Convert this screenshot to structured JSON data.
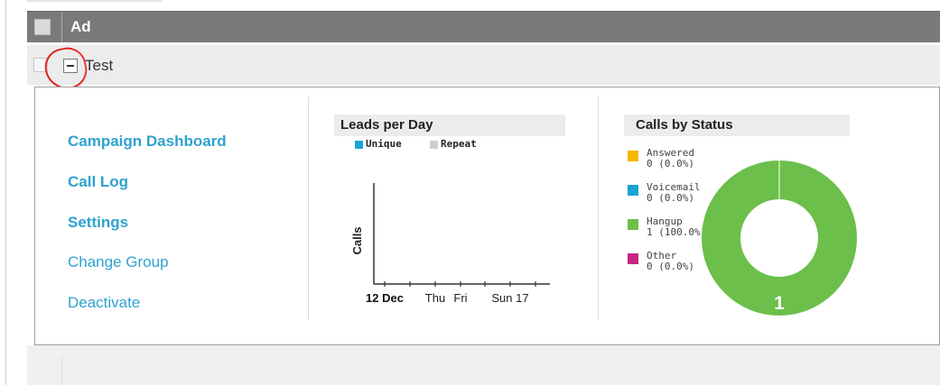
{
  "header": {
    "column_label": "Ad"
  },
  "group": {
    "name": "Test"
  },
  "links": [
    {
      "label": "Campaign Dashboard",
      "bold": true
    },
    {
      "label": "Call Log",
      "bold": true
    },
    {
      "label": "Settings",
      "bold": true
    },
    {
      "label": "Change Group",
      "bold": false
    },
    {
      "label": "Deactivate",
      "bold": false
    }
  ],
  "leads_chart": {
    "title": "Leads per Day",
    "legend": [
      {
        "label": "Unique",
        "color": "#1ba3d6"
      },
      {
        "label": "Repeat",
        "color": "#cfcfcf"
      }
    ],
    "ylabel": "Calls",
    "x_ticks": [
      "12 Dec",
      "Thu",
      "Fri",
      "Sun 17"
    ]
  },
  "status_chart": {
    "title": "Calls by Status",
    "center_count": "1",
    "colors": {
      "Answered": "#f5b800",
      "Voicemail": "#1ba3d6",
      "Hangup": "#6cbf4a",
      "Other": "#c8267f"
    }
  },
  "chart_data": [
    {
      "type": "bar",
      "title": "Leads per Day",
      "ylabel": "Calls",
      "categories": [
        "12 Dec",
        "Thu",
        "Fri",
        "Sun 17"
      ],
      "series": [
        {
          "name": "Unique",
          "values": [
            0,
            0,
            0,
            0
          ]
        },
        {
          "name": "Repeat",
          "values": [
            0,
            0,
            0,
            0
          ]
        }
      ]
    },
    {
      "type": "pie",
      "title": "Calls by Status",
      "slices": [
        {
          "name": "Answered",
          "count": 0,
          "count_text": "0 (0.0%)"
        },
        {
          "name": "Voicemail",
          "count": 0,
          "count_text": "0 (0.0%)"
        },
        {
          "name": "Hangup",
          "count": 1,
          "count_text": "1 (100.0%)"
        },
        {
          "name": "Other",
          "count": 0,
          "count_text": "0 (0.0%)"
        }
      ]
    }
  ]
}
